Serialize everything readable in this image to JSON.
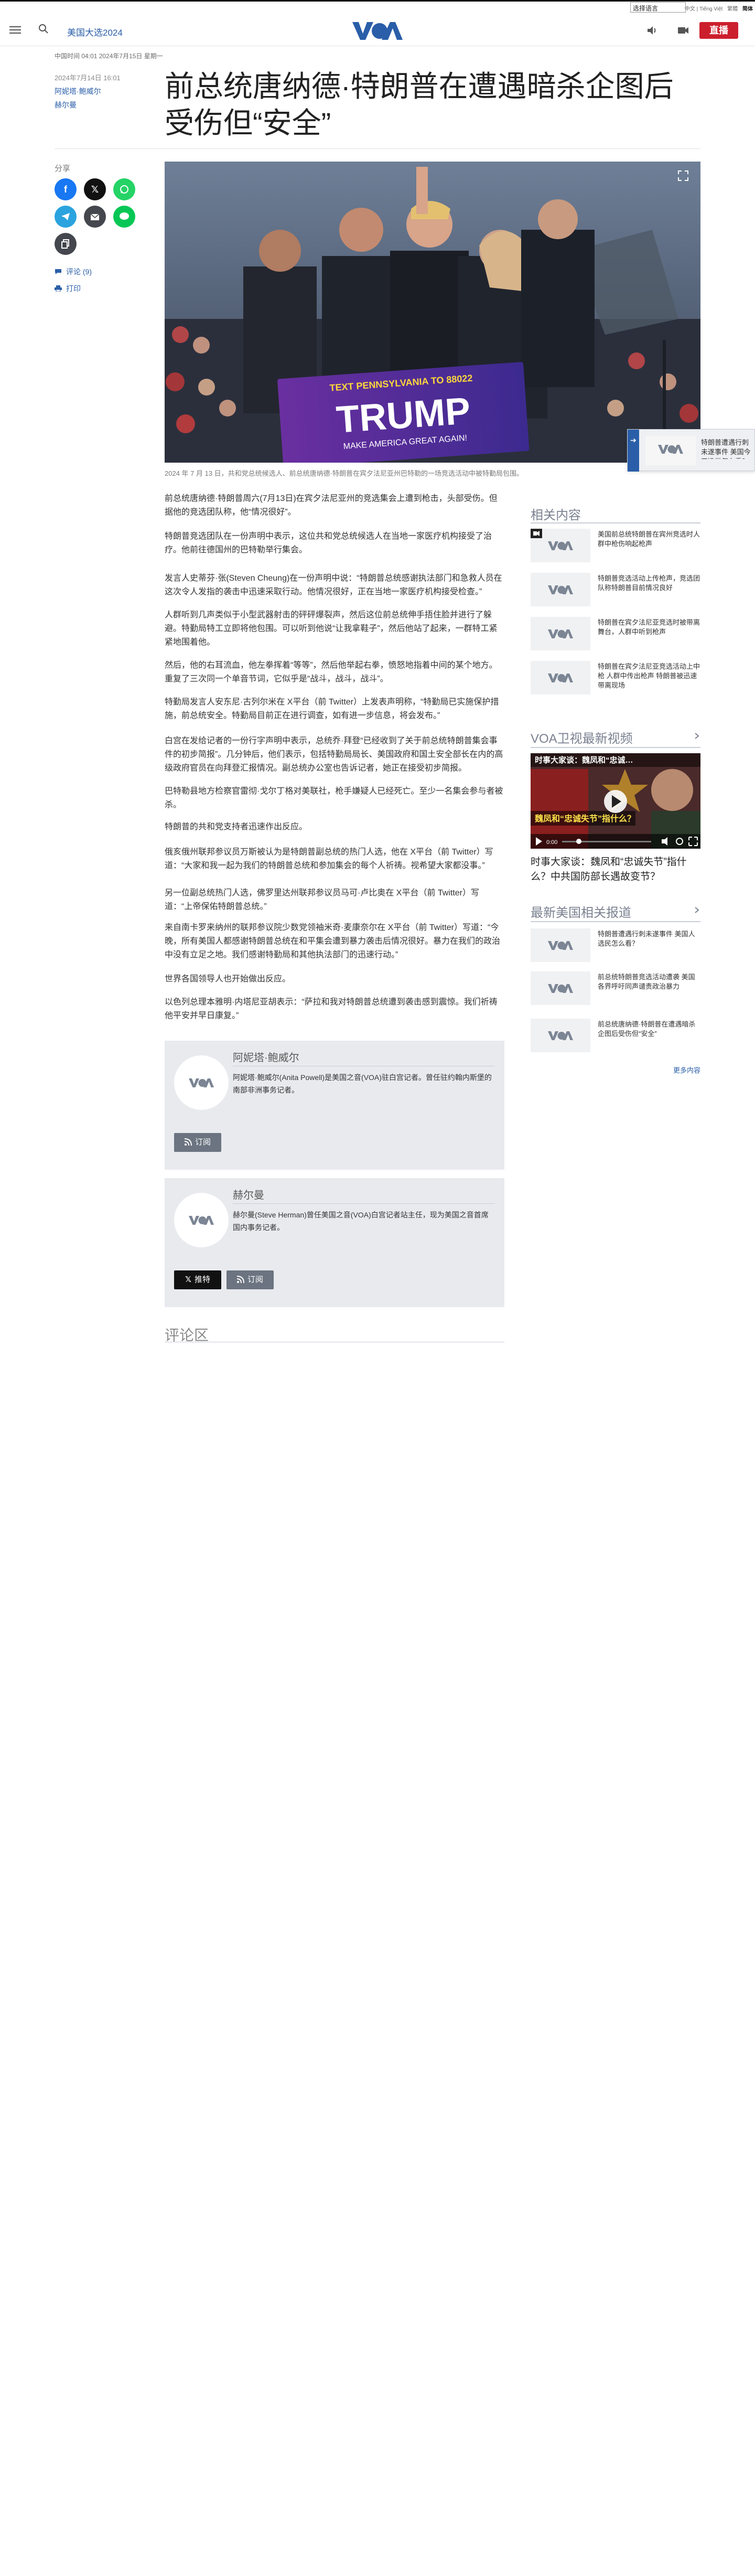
{
  "topbar": {
    "language_select": "选择语言",
    "traditional_label": "繁體",
    "simplified_label": "简体",
    "links_text": "中文 | Tiếng Việt"
  },
  "header": {
    "section_link": "美国大选2024",
    "live_label": "直播",
    "accent_color": "#2a5ea8",
    "live_color": "#cc1f2d"
  },
  "article": {
    "meta": "中国时间 04:01 2024年7月15日 星期一",
    "date_line": "2024年7月14日 16:01",
    "authors": [
      "阿妮塔·鲍威尔",
      "赫尔曼"
    ],
    "title": "前总统唐纳德·特朗普在遭遇暗杀企图后受伤但“安全”",
    "caption": "2024 年 7 月 13 日，共和党总统候选人、前总统唐纳德·特朗普在宾夕法尼亚州巴特勒的一场竞选活动中被特勤局包围。",
    "photo_sign_top": "TEXT PENNSYLVANIA TO 88022",
    "photo_sign_main": "TRUMP",
    "photo_sign_sub": "MAKE AMERICA GREAT AGAIN!",
    "paragraphs": [
      "前总统唐纳德·特朗普周六(7月13日)在宾夕法尼亚州的竞选集会上遭到枪击，头部受伤。但据他的竞选团队称，他“情况很好”。",
      "特朗普竞选团队在一份声明中表示，这位共和党总统候选人在当地一家医疗机构接受了治疗。他前往德国州的巴特勒举行集会。",
      "发言人史蒂芬·张(Steven Cheung)在一份声明中说：“特朗普总统感谢执法部门和急救人员在这次令人发指的袭击中迅速采取行动。他情况很好，正在当地一家医疗机构接受检查。”",
      "人群听到几声类似于小型武器射击的砰砰爆裂声，然后这位前总统伸手捂住脸并进行了躲避。特勤局特工立即将他包围。可以听到他说“让我拿鞋子”，然后他站了起来，一群特工紧紧地围着他。",
      "然后，他的右耳流血，他左拳挥着“等等”，然后他举起右拳，愤怒地指着中间的某个地方。重复了三次同一个单音节词，它似乎是“战斗，战斗，战斗”。",
      "特勤局发言人安东尼·古列尔米在 X平台（前 Twitter）上发表声明称，“特勤局已实施保护措施，前总统安全。特勤局目前正在进行调查，如有进一步信息，将会发布。”",
      "白宫在发给记者的一份行字声明中表示，总统乔·拜登“已经收到了关于前总统特朗普集会事件的初步简报”。几分钟后，他们表示，包括特勤局局长、美国政府和国土安全部长在内的高级政府官员在向拜登汇报情况。副总统办公室也告诉记者，她正在接受初步简报。",
      "巴特勒县地方检察官雷彻·戈尔丁格对美联社，枪手嫌疑人已经死亡。至少一名集会参与者被杀。",
      "特朗普的共和党支持者迅速作出反应。",
      "俄亥俄州联邦参议员万斯被认为是特朗普副总统的热门人选，他在 X平台（前 Twitter）写道：“大家和我一起为我们的特朗普总统和参加集会的每个人祈祷。视希望大家都没事。”",
      "另一位副总统热门人选，佛罗里达州联邦参议员马可·卢比奥在 X平台（前 Twitter）写道：“上帝保佑特朗普总统。”",
      "来自南卡罗来纳州的联邦参议院少数党领袖米奇·麦康奈尔在 X平台（前 Twitter）写道：“今晚，所有美国人都感谢特朗普总统在和平集会遭到暴力袭击后情况很好。暴力在我们的政治中没有立足之地。我们感谢特勤局和其他执法部门的迅速行动。”",
      "世界各国领导人也开始做出反应。",
      "以色列总理本雅明·内塔尼亚胡表示：“萨拉和我对特朗普总统遭到袭击感到震惊。我们祈祷他平安并早日康复。”"
    ]
  },
  "share": {
    "label": "分享",
    "comments_link": "评论 (9)",
    "print_link": "打印"
  },
  "author_boxes": [
    {
      "name": "阿妮塔·鲍威尔",
      "bio": "阿妮塔·鲍威尔(Anita Powell)是美国之音(VOA)驻白宫记者。曾任驻约翰内斯堡的南部非洲事务记者。",
      "subscribe": "订阅"
    },
    {
      "name": "赫尔曼",
      "bio": "赫尔曼(Steve Herman)曾任美国之音(VOA)白宫记者站主任，现为美国之音首席国内事务记者。",
      "follow": "推特",
      "subscribe": "订阅"
    }
  ],
  "comments_title": "评论区",
  "floater": {
    "text": "特朗普遭遇行刺未遂事件 美国今天选举怎么看？"
  },
  "related": {
    "title": "相关内容",
    "items": [
      "美国前总统特朗普在宾州竞选时人群中枪伤响起枪声",
      "特朗普竞选活动上传枪声，竞选团队称特朗普目前情况良好",
      "特朗普在宾夕法尼亚竞选时被带离舞台，人群中听到枪声",
      "特朗普在宾夕法尼亚竞选活动上中枪 人群中传出枪声 特朗普被迅速带离现场"
    ]
  },
  "video_section": {
    "title": "VOA卫视最新视频",
    "video_title_overlay": "时事大家谈：魏凤和“忠诚…",
    "video_sub_overlay": "魏凤和“忠诚失节”指什么？",
    "caption": "时事大家谈：魏凤和“忠诚失节”指什么？中共国防部长遇故变节？",
    "time": "0:00"
  },
  "latest": {
    "title": "最新美国相关报道",
    "items": [
      "特朗普遭遇行刺未遂事件 美国人选民怎么看？",
      "前总统特朗普竞选活动遭袭 美国各界呼吁同声谴责政治暴力",
      "前总统唐纳德·特朗普在遭遇暗杀企图后受伤但“安全”"
    ],
    "more": "更多内容"
  }
}
